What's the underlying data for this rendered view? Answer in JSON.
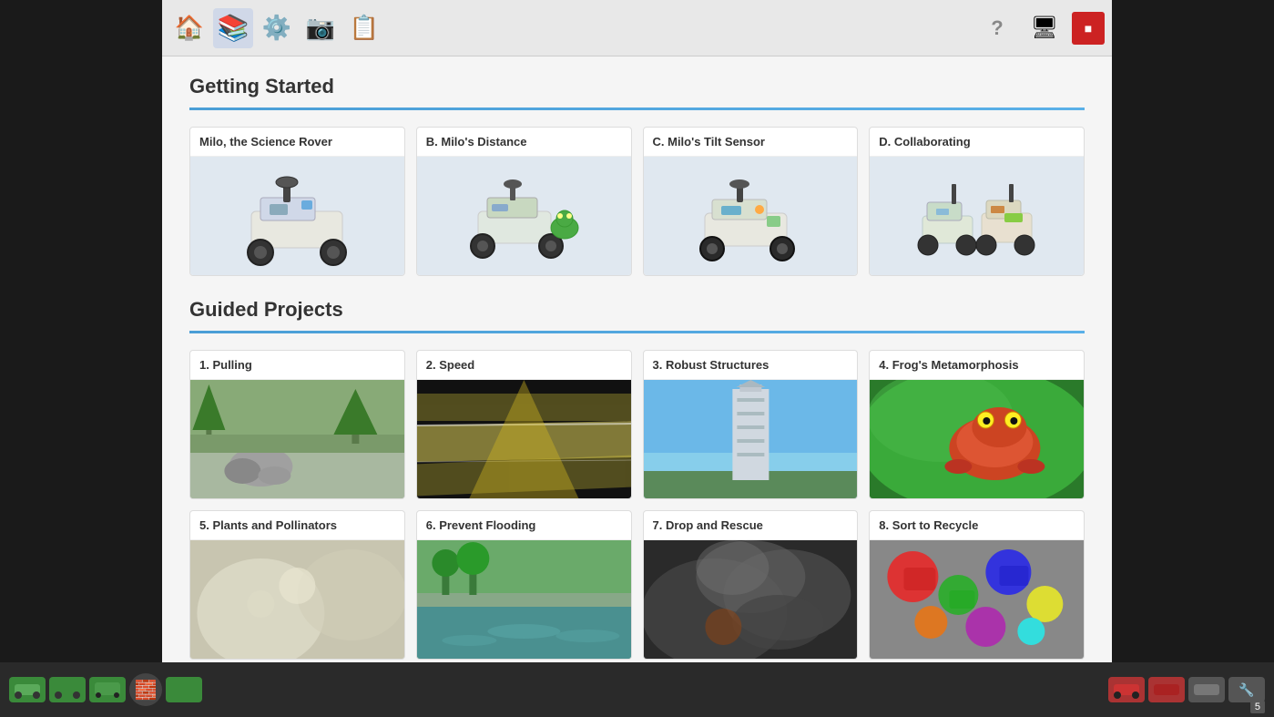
{
  "toolbar": {
    "icons": [
      {
        "name": "home-icon",
        "symbol": "🏠",
        "active": false,
        "label": "Home"
      },
      {
        "name": "book-icon",
        "symbol": "📚",
        "active": true,
        "label": "Books"
      },
      {
        "name": "gear-icon",
        "symbol": "⚙️",
        "active": false,
        "label": "Settings"
      },
      {
        "name": "camera-icon",
        "symbol": "📷",
        "active": false,
        "label": "Camera"
      },
      {
        "name": "clipboard-icon",
        "symbol": "📋",
        "active": false,
        "label": "Clipboard"
      }
    ],
    "right_icons": [
      {
        "name": "help-icon",
        "symbol": "?",
        "label": "Help"
      },
      {
        "name": "monitor-icon",
        "symbol": "🖥",
        "label": "Monitor"
      },
      {
        "name": "stop-icon",
        "symbol": "🟥",
        "label": "Stop"
      }
    ]
  },
  "getting_started": {
    "heading": "Getting Started",
    "cards": [
      {
        "title": "Milo, the Science Rover",
        "emoji": "🤖"
      },
      {
        "title": "B. Milo's Distance",
        "emoji": "🤖"
      },
      {
        "title": "C. Milo's Tilt Sensor",
        "emoji": "🤖"
      },
      {
        "title": "D. Collaborating",
        "emoji": "🤖"
      }
    ]
  },
  "guided_projects": {
    "heading": "Guided Projects",
    "cards": [
      {
        "title": "1. Pulling",
        "thumb_class": "thumb-pulling",
        "emoji": "🪨"
      },
      {
        "title": "2. Speed",
        "thumb_class": "thumb-speed",
        "emoji": ""
      },
      {
        "title": "3. Robust Structures",
        "thumb_class": "thumb-robust",
        "emoji": "🗼"
      },
      {
        "title": "4. Frog's Metamorphosis",
        "thumb_class": "thumb-frog",
        "emoji": "🐸"
      },
      {
        "title": "5. Plants and Pollinators",
        "thumb_class": "thumb-plants",
        "emoji": ""
      },
      {
        "title": "6. Prevent Flooding",
        "thumb_class": "thumb-flooding",
        "emoji": ""
      },
      {
        "title": "7. Drop and Rescue",
        "thumb_class": "thumb-drop",
        "emoji": ""
      },
      {
        "title": "8. Sort to Recycle",
        "thumb_class": "thumb-recycle",
        "emoji": ""
      }
    ]
  },
  "bottom_bar": {
    "page_number": "5",
    "corner_icon": "🧱"
  }
}
